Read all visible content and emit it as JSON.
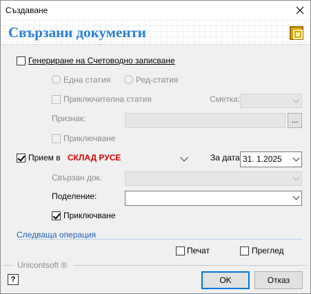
{
  "window": {
    "title": "Създаване"
  },
  "header": {
    "title": "Свързани документи"
  },
  "accounting": {
    "generate_label": "Генериране на Счетоводно записване",
    "generate_checked": false,
    "one_article_label": "Една статия",
    "row_article_label": "Ред-статия",
    "closing_article_label": "Приключителна статия",
    "account_label": "Сметка:",
    "account_value": "",
    "sign_label": "Признак:",
    "sign_value": "",
    "ellipsis_label": "...",
    "closing_label": "Приключване"
  },
  "receipt": {
    "label": "Прием в",
    "checked": true,
    "warehouse": "СКЛАД РУСЕ",
    "date_label": "За дата:",
    "date_value": "31.  1.2025",
    "linked_doc_label": "Свързан док.",
    "linked_doc_value": "",
    "division_label": "Поделение:",
    "division_value": "",
    "closing_label": "Приключване",
    "closing_checked": true
  },
  "next_operation_label": "Следваща операция",
  "options": {
    "print_label": "Печат",
    "preview_label": "Преглед"
  },
  "footer": {
    "brand": "Unicontsoft ®",
    "help_label": "?",
    "ok_label": "OK",
    "cancel_label": "Отказ"
  },
  "colors": {
    "header_title": "#2a7fd4",
    "warehouse": "#e00000",
    "link": "#1e5fb4",
    "default_button_border": "#0078d7"
  }
}
